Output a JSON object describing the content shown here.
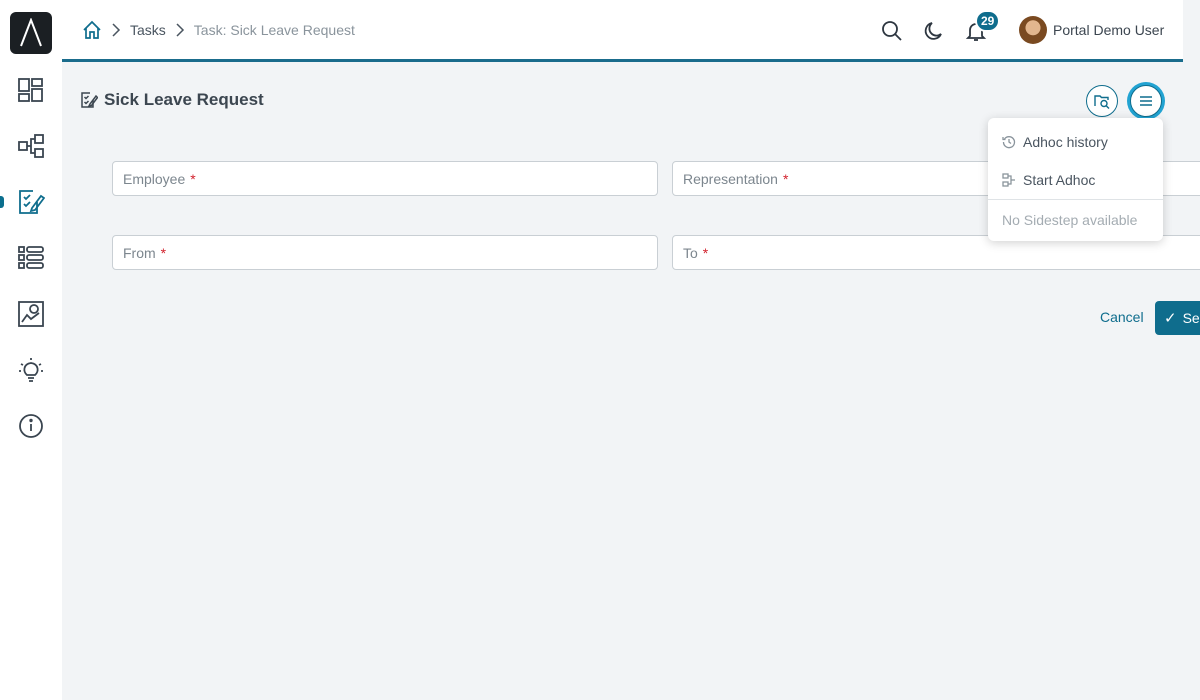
{
  "breadcrumb": {
    "items": [
      "Tasks",
      "Task: Sick Leave Request"
    ]
  },
  "header": {
    "notification_count": "29",
    "user_name": "Portal Demo User"
  },
  "page": {
    "title": "Sick Leave Request"
  },
  "form": {
    "employee_label": "Employee",
    "representation_label": "Representation",
    "from_label": "From",
    "to_label": "To",
    "required_marker": "*",
    "cancel_label": "Cancel",
    "send_label": "Ser"
  },
  "menu": {
    "items": [
      "Adhoc history",
      "Start Adhoc"
    ],
    "disabled_note": "No Sidestep available"
  },
  "colors": {
    "accent": "#0f6d8d",
    "accent_ring": "#22a3d2",
    "required": "#d2222d",
    "background": "#f2f4f6"
  },
  "icons": {
    "sidebar": [
      "dashboard-icon",
      "process-icon",
      "tasks-icon",
      "list-icon",
      "statistics-icon",
      "ideas-icon",
      "info-icon"
    ],
    "header": [
      "home-icon",
      "search-icon",
      "dark-mode-icon",
      "bell-icon"
    ]
  }
}
